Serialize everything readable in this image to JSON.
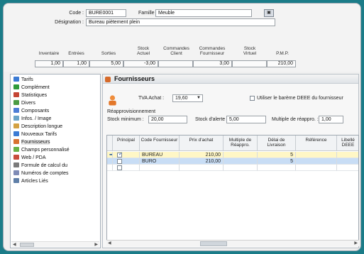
{
  "header": {
    "code_label": "Code :",
    "code_value": "BURE0001",
    "famille_label": "Famille :",
    "famille_value": "Meuble",
    "designation_label": "Désignation :",
    "designation_value": "Bureau piètement plein"
  },
  "stock": {
    "columns": [
      {
        "label": "Inventaire",
        "value": "1,00"
      },
      {
        "label": "Entrées",
        "value": "1,00"
      },
      {
        "label": "Sorties",
        "value": "5,00"
      },
      {
        "label": "Stock\nActuel",
        "value": "-3,00"
      },
      {
        "label": "Commandes\nClient",
        "value": ""
      },
      {
        "label": "Commandes\nFournisseur",
        "value": "3,00"
      },
      {
        "label": "Stock\nVirtuel",
        "value": ""
      },
      {
        "label": "P.M.P.",
        "value": "210,00"
      }
    ]
  },
  "sidebar": {
    "items": [
      {
        "label": "Tarifs",
        "icon": "tarifs-icon",
        "color": "#3b7bd4"
      },
      {
        "label": "Complément",
        "icon": "complement-icon",
        "color": "#2f9b3a"
      },
      {
        "label": "Statistiques",
        "icon": "statistics-icon",
        "color": "#c44535"
      },
      {
        "label": "Divers",
        "icon": "divers-icon",
        "color": "#4b9b44"
      },
      {
        "label": "Composants",
        "icon": "components-icon",
        "color": "#4d7ed6"
      },
      {
        "label": "Infos. / Image",
        "icon": "info-image-icon",
        "color": "#6aa4c8"
      },
      {
        "label": "Description longue",
        "icon": "description-icon",
        "color": "#d3a143"
      },
      {
        "label": "Nouveaux Tarifs",
        "icon": "new-tariffs-icon",
        "color": "#3b7bd4"
      },
      {
        "label": "Fournisseurs",
        "icon": "suppliers-icon",
        "color": "#d87230"
      },
      {
        "label": "Champs personnalisé",
        "icon": "custom-fields-icon",
        "color": "#67b247"
      },
      {
        "label": "Web / PDA",
        "icon": "web-pda-icon",
        "color": "#c84c3c"
      },
      {
        "label": "Formule de calcul du",
        "icon": "formula-icon",
        "color": "#7a7a7a"
      },
      {
        "label": "Numéros de comptes",
        "icon": "account-numbers-icon",
        "color": "#7e8bb6"
      },
      {
        "label": "Articles Liés",
        "icon": "linked-items-icon",
        "color": "#5f7fa8"
      }
    ]
  },
  "panel": {
    "title": "Fournisseurs",
    "tva_label": "TVA Achat :",
    "tva_value": "19,60",
    "deee_label": "Utiliser le barème DEEE du fournisseur",
    "reappro_label": "Réapprovisionnement",
    "stock_min_label": "Stock minimum :",
    "stock_min_value": "20,00",
    "stock_alert_label": "Stock d'alerte :",
    "stock_alert_value": "5,00",
    "multiple_label": "Multiple de réappro. :",
    "multiple_value": "1,00"
  },
  "grid": {
    "headers": [
      "Principal",
      "Code Fournisseur",
      "Prix d'achat",
      "Multiple de\nRéappro.",
      "Délai de\nLivraison",
      "Référence",
      "Libellé\nDEEE"
    ],
    "rows": [
      {
        "principal": true,
        "code": "BUREAU",
        "prix": "210,00",
        "multiple": "",
        "delai": "5",
        "reference": "",
        "libelle": "",
        "selected": true
      },
      {
        "principal": false,
        "code": "BURO",
        "prix": "210,00",
        "multiple": "",
        "delai": "5",
        "reference": "",
        "libelle": "",
        "selected": false
      }
    ]
  }
}
